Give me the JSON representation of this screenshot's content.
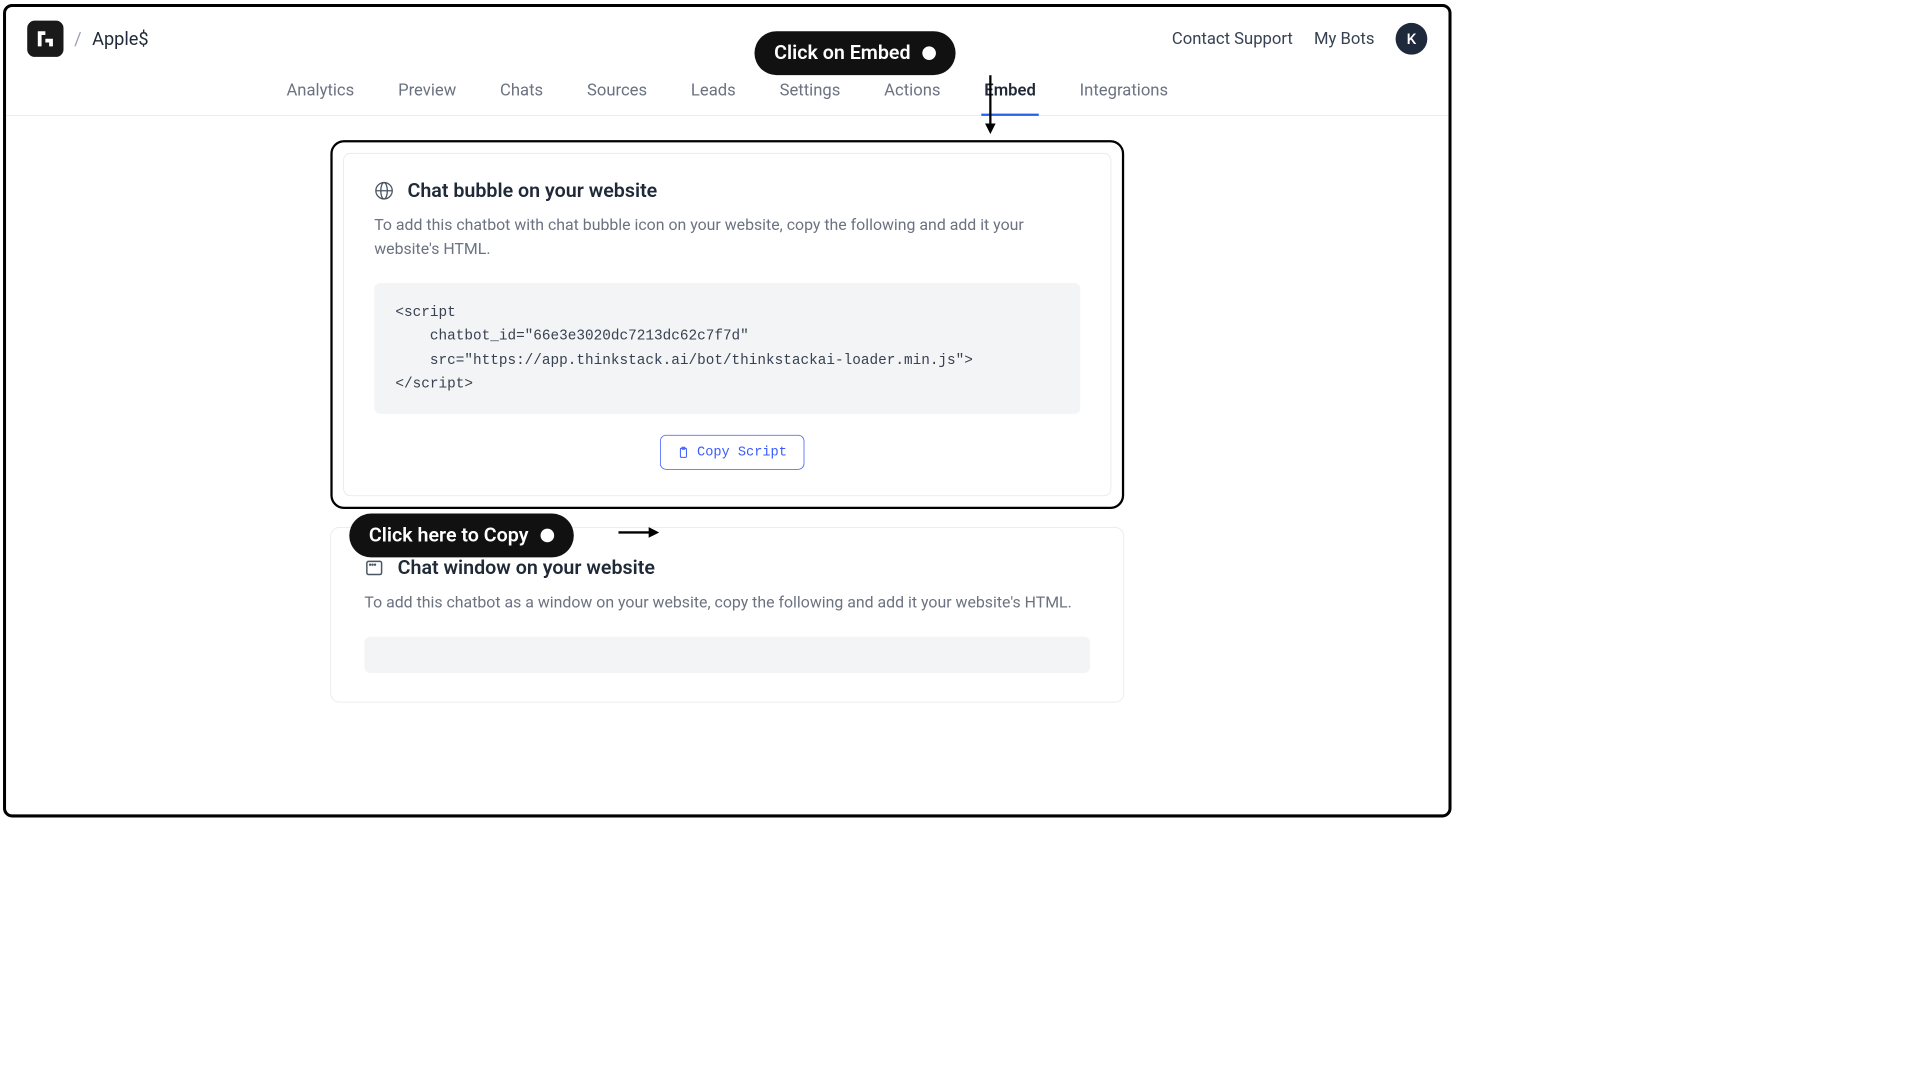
{
  "header": {
    "bot_name": "Apple$",
    "breadcrumb_separator": "/",
    "contact_support": "Contact Support",
    "my_bots": "My Bots",
    "avatar_initial": "K"
  },
  "tabs": [
    {
      "label": "Analytics",
      "active": false
    },
    {
      "label": "Preview",
      "active": false
    },
    {
      "label": "Chats",
      "active": false
    },
    {
      "label": "Sources",
      "active": false
    },
    {
      "label": "Leads",
      "active": false
    },
    {
      "label": "Settings",
      "active": false
    },
    {
      "label": "Actions",
      "active": false
    },
    {
      "label": "Embed",
      "active": true
    },
    {
      "label": "Integrations",
      "active": false
    }
  ],
  "card1": {
    "title": "Chat bubble on your website",
    "description": "To add this chatbot with chat bubble icon on your website, copy the following and add it your website's HTML.",
    "code": "<script\n    chatbot_id=\"66e3e3020dc7213dc62c7f7d\"\n    src=\"https://app.thinkstack.ai/bot/thinkstackai-loader.min.js\">\n</script>",
    "copy_label": "Copy Script"
  },
  "card2": {
    "title": "Chat window on your website",
    "description": "To add this chatbot as a window on your website, copy the following and add it your website's HTML."
  },
  "annotations": {
    "embed_callout": "Click on Embed",
    "copy_callout": "Click here to Copy"
  }
}
